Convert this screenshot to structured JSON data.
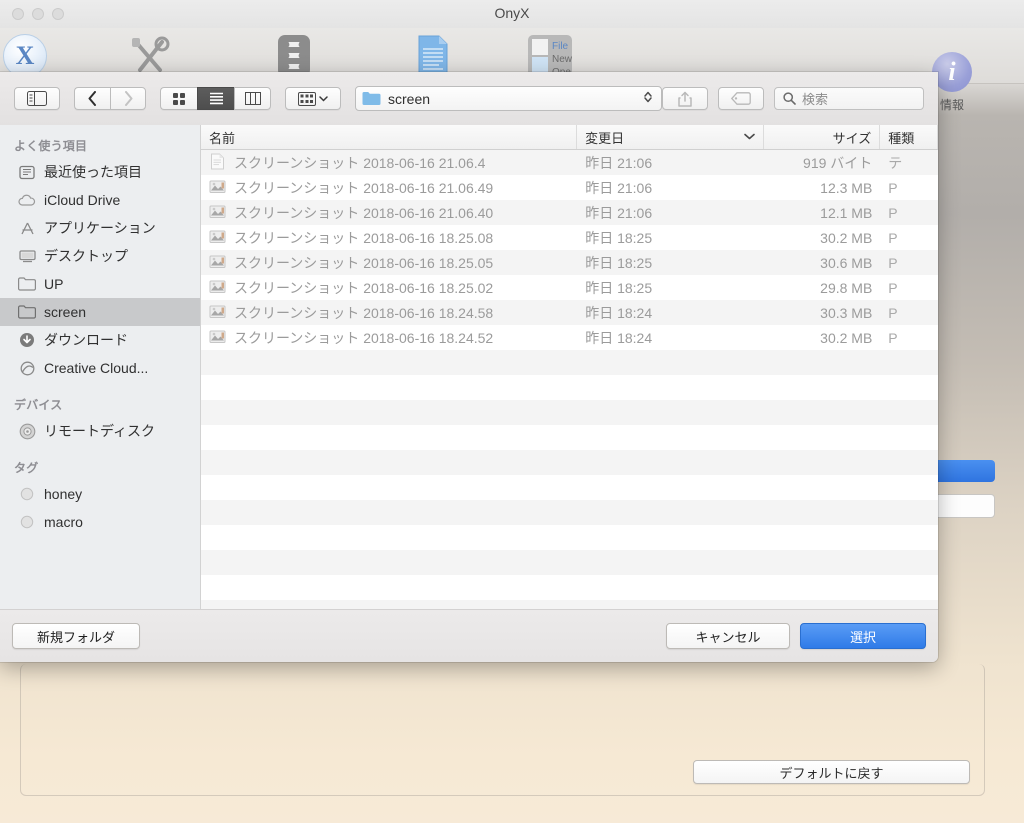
{
  "window": {
    "title": "OnyX",
    "traffic_lights": [
      "close",
      "minimize",
      "zoom"
    ]
  },
  "onyx_toolbar": {
    "items": [
      {
        "name": "onyx-logo",
        "icon": "x-logo-icon",
        "label": ""
      },
      {
        "name": "maintenance",
        "icon": "tools-icon",
        "label": ""
      },
      {
        "name": "utilities",
        "icon": "wrenches-icon",
        "label": ""
      },
      {
        "name": "parameters",
        "icon": "document-icon",
        "label": ""
      },
      {
        "name": "files",
        "icon": "file-new-open-icon",
        "label": ""
      }
    ],
    "info": {
      "label": "情報",
      "icon": "info-icon"
    }
  },
  "background": {
    "restore_defaults_label": "デフォルトに戻す"
  },
  "dialog": {
    "toolbar": {
      "sidebar_toggle_icon": "sidebar-toggle-icon",
      "back_icon": "chevron-left-icon",
      "forward_icon": "chevron-right-icon",
      "view_icon_label": "icon-view-icon",
      "view_list_label": "list-view-icon",
      "view_column_label": "column-view-icon",
      "arrange_icon": "arrange-by-icon",
      "path_folder": "screen",
      "share_icon": "share-icon",
      "tag_icon": "tag-icon",
      "search_placeholder": "検索",
      "search_value": ""
    },
    "sidebar": {
      "sections": [
        {
          "header": "よく使う項目",
          "items": [
            {
              "label": "最近使った項目",
              "icon": "recents-icon",
              "selected": false
            },
            {
              "label": "iCloud Drive",
              "icon": "cloud-icon",
              "selected": false
            },
            {
              "label": "アプリケーション",
              "icon": "applications-icon",
              "selected": false
            },
            {
              "label": "デスクトップ",
              "icon": "desktop-icon",
              "selected": false
            },
            {
              "label": "UP",
              "icon": "folder-icon",
              "selected": false
            },
            {
              "label": "screen",
              "icon": "folder-icon",
              "selected": true
            },
            {
              "label": "ダウンロード",
              "icon": "downloads-icon",
              "selected": false
            },
            {
              "label": "Creative Cloud...",
              "icon": "creative-cloud-icon",
              "selected": false
            }
          ]
        },
        {
          "header": "デバイス",
          "items": [
            {
              "label": "リモートディスク",
              "icon": "remote-disc-icon",
              "selected": false
            }
          ]
        },
        {
          "header": "タグ",
          "items": [
            {
              "label": "honey",
              "icon": "tag-dot-icon",
              "selected": false
            },
            {
              "label": "macro",
              "icon": "tag-dot-icon",
              "selected": false
            }
          ]
        }
      ]
    },
    "filelist": {
      "columns": [
        {
          "key": "name",
          "label": "名前",
          "sorted": false
        },
        {
          "key": "date",
          "label": "変更日",
          "sorted": true,
          "direction": "descending"
        },
        {
          "key": "size",
          "label": "サイズ",
          "sorted": false
        },
        {
          "key": "kind",
          "label": "種類",
          "sorted": false
        }
      ],
      "rows": [
        {
          "name": "スクリーンショット 2018-06-16 21.06.4",
          "date": "昨日 21:06",
          "size": "919 バイト",
          "kind": "テ",
          "icon": "text-document-icon"
        },
        {
          "name": "スクリーンショット 2018-06-16 21.06.49",
          "date": "昨日 21:06",
          "size": "12.3 MB",
          "kind": "P",
          "icon": "image-file-icon"
        },
        {
          "name": "スクリーンショット 2018-06-16 21.06.40",
          "date": "昨日 21:06",
          "size": "12.1 MB",
          "kind": "P",
          "icon": "image-file-icon"
        },
        {
          "name": "スクリーンショット 2018-06-16 18.25.08",
          "date": "昨日 18:25",
          "size": "30.2 MB",
          "kind": "P",
          "icon": "image-file-icon"
        },
        {
          "name": "スクリーンショット 2018-06-16 18.25.05",
          "date": "昨日 18:25",
          "size": "30.6 MB",
          "kind": "P",
          "icon": "image-file-icon"
        },
        {
          "name": "スクリーンショット 2018-06-16 18.25.02",
          "date": "昨日 18:25",
          "size": "29.8 MB",
          "kind": "P",
          "icon": "image-file-icon"
        },
        {
          "name": "スクリーンショット 2018-06-16 18.24.58",
          "date": "昨日 18:24",
          "size": "30.3 MB",
          "kind": "P",
          "icon": "image-file-icon"
        },
        {
          "name": "スクリーンショット 2018-06-16 18.24.52",
          "date": "昨日 18:24",
          "size": "30.2 MB",
          "kind": "P",
          "icon": "image-file-icon"
        }
      ]
    },
    "footer": {
      "new_folder_label": "新規フォルダ",
      "cancel_label": "キャンセル",
      "choose_label": "選択"
    }
  },
  "colors": {
    "accent_blue": "#2f7be8",
    "sidebar_bg": "#eceef0",
    "selected_row": "#c8c9cb",
    "folder_blue": "#7fbbe8"
  }
}
